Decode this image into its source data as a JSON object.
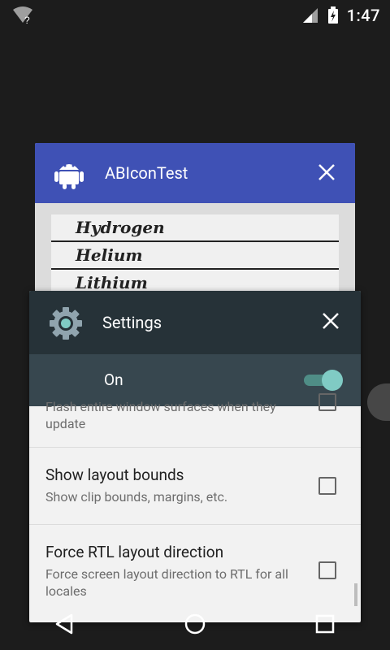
{
  "status_bar": {
    "time": "1:47",
    "wifi_badge": "?"
  },
  "recents": {
    "back_card": {
      "title": "ABIconTest",
      "header_color": "#3f51b5",
      "list": [
        "Hydrogen",
        "Helium",
        "Lithium"
      ]
    },
    "front_card": {
      "title": "Settings",
      "header_color": "#263238",
      "master_switch": {
        "label": "On",
        "state": true
      },
      "prefs": [
        {
          "title": "",
          "summary": "Flash entire window surfaces when they update",
          "checked": false
        },
        {
          "title": "Show layout bounds",
          "summary": "Show clip bounds, margins, etc.",
          "checked": false
        },
        {
          "title": "Force RTL layout direction",
          "summary": "Force screen layout direction to RTL for all locales",
          "checked": false
        }
      ]
    }
  },
  "nav": {
    "back": "back-icon",
    "home": "home-icon",
    "recents": "recents-icon"
  }
}
